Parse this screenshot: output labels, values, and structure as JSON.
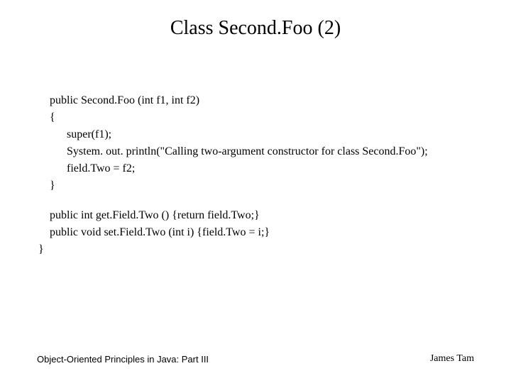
{
  "title": "Class Second.Foo (2)",
  "code": {
    "l1": "public Second.Foo (int f1, int f2)",
    "l2": "{",
    "l3": "super(f1);",
    "l4": "System. out. println(\"Calling two-argument constructor for class Second.Foo\");",
    "l5": "field.Two = f2;",
    "l6": "}",
    "l7": "public int get.Field.Two () {return field.Two;}",
    "l8": "public void set.Field.Two (int i) {field.Two = i;}",
    "l9": "}"
  },
  "footer": {
    "left": "Object-Oriented Principles in Java: Part III",
    "right": "James Tam"
  }
}
